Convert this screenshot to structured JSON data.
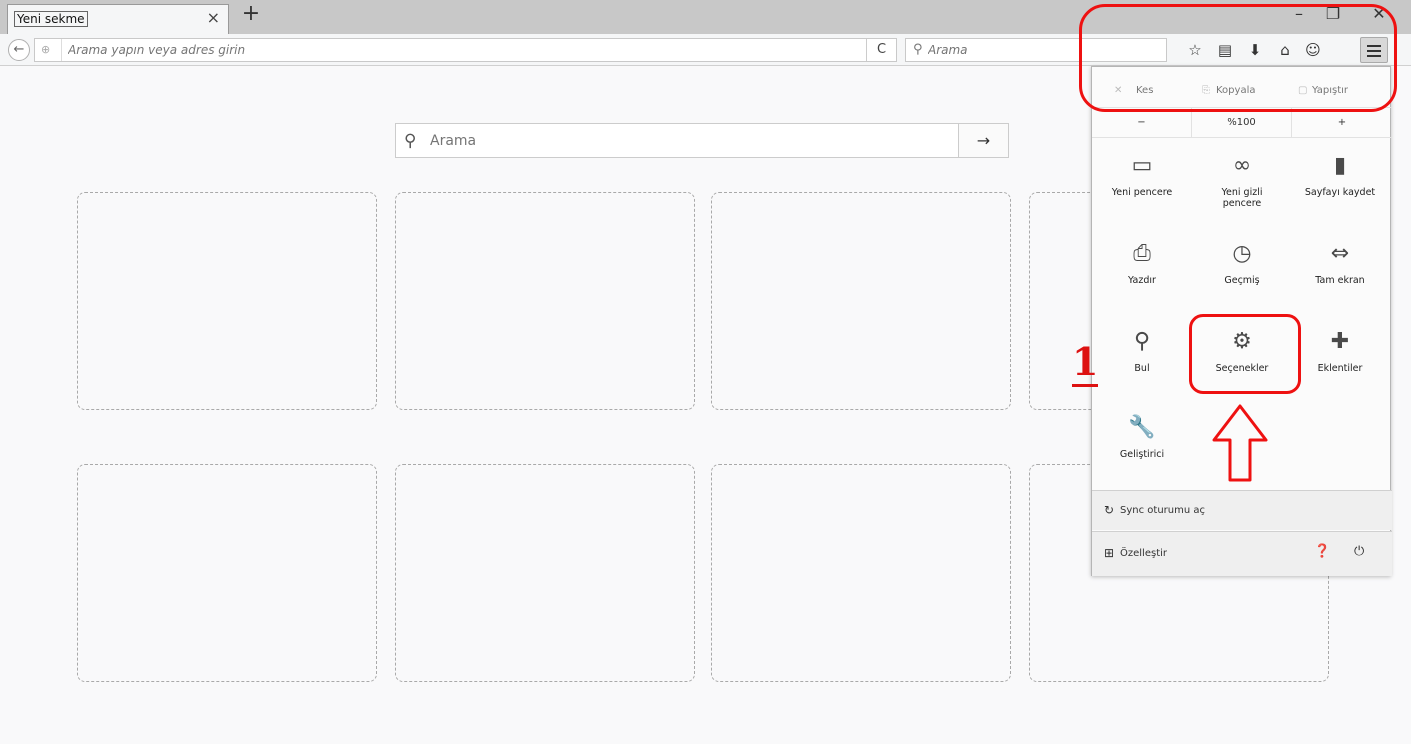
{
  "tabbar": {
    "tab_title": "Yeni sekme",
    "tab_close_icon": "×",
    "new_tab_icon": "+",
    "window_controls": {
      "minimize": "–",
      "maximize": "❐",
      "close": "✕"
    }
  },
  "navbar": {
    "url_placeholder": "Arama yapın veya adres girin",
    "reload_icon": "C",
    "search_placeholder": "Arama",
    "icons": [
      "star-icon",
      "clipboard-icon",
      "download-icon",
      "home-icon",
      "chat-icon",
      "hamburger-menu-icon"
    ]
  },
  "newtab": {
    "search_placeholder": "Arama",
    "search_go_icon": "→"
  },
  "panel": {
    "edit": {
      "cut": "Kes",
      "copy": "Kopyala",
      "paste": "Yapıştır"
    },
    "zoom": {
      "out": "−",
      "level": "%100",
      "in": "+"
    },
    "items": [
      {
        "label": "Yeni pencere",
        "icon": "window-icon",
        "glyph": "▭"
      },
      {
        "label": "Yeni gizli pencere",
        "icon": "private-mask-icon",
        "glyph": "∞"
      },
      {
        "label": "Sayfayı kaydet",
        "icon": "page-icon",
        "glyph": "▮"
      },
      {
        "label": "Yazdır",
        "icon": "print-icon",
        "glyph": "⎙"
      },
      {
        "label": "Geçmiş",
        "icon": "history-clock-icon",
        "glyph": "◷"
      },
      {
        "label": "Tam ekran",
        "icon": "fullscreen-icon",
        "glyph": "⇔"
      },
      {
        "label": "Bul",
        "icon": "find-icon",
        "glyph": "⚲"
      },
      {
        "label": "Seçenekler",
        "icon": "gear-icon",
        "glyph": "⚙"
      },
      {
        "label": "Eklentiler",
        "icon": "puzzle-icon",
        "glyph": "✚"
      },
      {
        "label": "Geliştirici",
        "icon": "wrench-icon",
        "glyph": "🔧"
      }
    ],
    "sync": "Sync oturumu aç",
    "customize": "Özelleştir"
  },
  "annotations": {
    "step_number": "1",
    "color": "#e11111"
  }
}
